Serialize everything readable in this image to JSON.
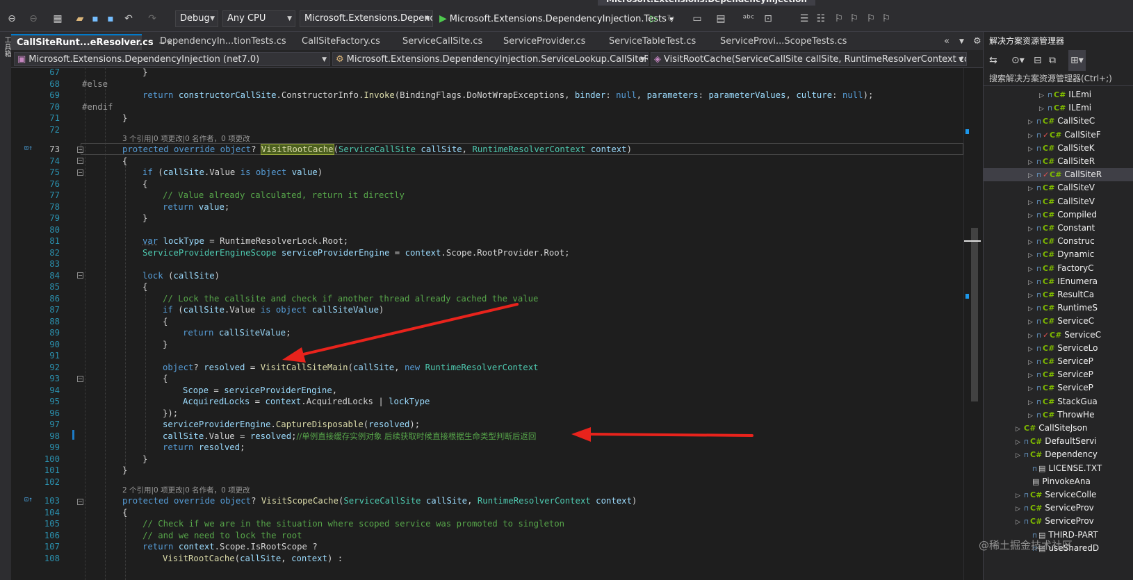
{
  "window": {
    "title": "Microsoft.Extensions.DependencyInjection"
  },
  "toolbar": {
    "config": "Debug",
    "platform": "Any CPU",
    "startup_project": "Microsoft.Extensions.Dependen",
    "run_target": "Microsoft.Extensions.DependencyInjection.Tests"
  },
  "left_strip": {
    "label": "工具箱"
  },
  "tabs": [
    {
      "label": "CallSiteRunt...eResolver.cs",
      "active": true
    },
    {
      "label": "DependencyIn...tionTests.cs"
    },
    {
      "label": "CallSiteFactory.cs"
    },
    {
      "label": "ServiceCallSite.cs"
    },
    {
      "label": "ServiceProvider.cs"
    },
    {
      "label": "ServiceTableTest.cs"
    },
    {
      "label": "ServiceProvi...ScopeTests.cs"
    }
  ],
  "navbar": {
    "project": "Microsoft.Extensions.DependencyInjection (net7.0)",
    "type": "Microsoft.Extensions.DependencyInjection.ServiceLookup.CallSiteRuntimeRe",
    "member": "VisitRootCache(ServiceCallSite callSite, RuntimeResolverContext context)"
  },
  "codelens": {
    "l72": "3 个引用|0 项更改|0 名作者，0 项更改",
    "l102": "2 个引用|0 项更改|0 名作者，0 项更改"
  },
  "code": {
    "l67": "}",
    "l68a": "#else",
    "l69a": "return ",
    "l69b": "constructorCallSite",
    "l69c": ".ConstructorInfo.",
    "l69d": "Invoke",
    "l69e": "(BindingFlags.DoNotWrapExceptions, ",
    "l69f": "binder",
    "l69g": ": ",
    "l69h": "null",
    "l69i": ", ",
    "l69j": "parameters",
    "l69k": ": ",
    "l69l": "parameterValues",
    "l69m": ", ",
    "l69n": "culture",
    "l69o": ": ",
    "l69p": "null",
    "l69q": ");",
    "l70a": "#endif",
    "l71": "}",
    "l73a": "protected override object",
    "l73b": "? ",
    "l73c": "VisitRootCache",
    "l73d": "(",
    "l73e": "ServiceCallSite",
    "l73f": " callSite",
    "l73g": ", ",
    "l73h": "RuntimeResolverContext",
    "l73i": " context",
    "l73j": ")",
    "l74": "{",
    "l75a": "if",
    "l75b": " (",
    "l75c": "callSite",
    "l75d": ".Value ",
    "l75e": "is object",
    "l75f": " value",
    "l75g": ")",
    "l76": "{",
    "l77": "// Value already calculated, return it directly",
    "l78a": "return",
    "l78b": " value",
    "l78c": ";",
    "l79": "}",
    "l81a": "var",
    "l81b": " lockType",
    "l81c": " = RuntimeResolverLock.Root;",
    "l82a": "ServiceProviderEngineScope",
    "l82b": " serviceProviderEngine",
    "l82c": " = ",
    "l82d": "context",
    "l82e": ".Scope.RootProvider.Root;",
    "l84a": "lock",
    "l84b": " (",
    "l84c": "callSite",
    "l84d": ")",
    "l85": "{",
    "l86": "// Lock the callsite and check if another thread already cached the value",
    "l87a": "if",
    "l87b": " (",
    "l87c": "callSite",
    "l87d": ".Value ",
    "l87e": "is object",
    "l87f": " callSiteValue",
    "l87g": ")",
    "l88": "{",
    "l89a": "return",
    "l89b": " callSiteValue",
    "l89c": ";",
    "l90": "}",
    "l92a": "object",
    "l92b": "? ",
    "l92c": "resolved",
    "l92d": " = ",
    "l92e": "VisitCallSiteMain",
    "l92f": "(",
    "l92g": "callSite",
    "l92h": ", ",
    "l92i": "new",
    "l92j": " RuntimeResolverContext",
    "l93": "{",
    "l94a": "Scope",
    "l94b": " = ",
    "l94c": "serviceProviderEngine",
    "l94d": ",",
    "l95a": "AcquiredLocks",
    "l95b": " = ",
    "l95c": "context",
    "l95d": ".AcquiredLocks | ",
    "l95e": "lockType",
    "l96": "});",
    "l97a": "serviceProviderEngine",
    "l97b": ".",
    "l97c": "CaptureDisposable",
    "l97d": "(",
    "l97e": "resolved",
    "l97f": ");",
    "l98a": "callSite",
    "l98b": ".Value = ",
    "l98c": "resolved",
    "l98d": ";",
    "l98e": "//单例直接缓存实例对象 后续获取时候直接根据生命类型判断后返回",
    "l99a": "return",
    "l99b": " resolved",
    "l99c": ";",
    "l100": "}",
    "l101": "}",
    "l103a": "protected override object",
    "l103b": "? ",
    "l103c": "VisitScopeCache",
    "l103d": "(",
    "l103e": "ServiceCallSite",
    "l103f": " callSite",
    "l103g": ", ",
    "l103h": "RuntimeResolverContext",
    "l103i": " context",
    "l103j": ")",
    "l104": "{",
    "l105": "// Check if we are in the situation where scoped service was promoted to singleton",
    "l106": "// and we need to lock the root",
    "l107a": "return",
    "l107b": " context",
    "l107c": ".Scope.IsRootScope ?",
    "l108a": "VisitRootCache",
    "l108b": "(",
    "l108c": "callSite",
    "l108d": ", ",
    "l108e": "context",
    "l108f": ") :"
  },
  "line_numbers": [
    "67",
    "68",
    "69",
    "70",
    "71",
    "72",
    "73",
    "74",
    "75",
    "76",
    "77",
    "78",
    "79",
    "80",
    "81",
    "82",
    "83",
    "84",
    "85",
    "86",
    "87",
    "88",
    "89",
    "90",
    "91",
    "92",
    "93",
    "94",
    "95",
    "96",
    "97",
    "98",
    "99",
    "100",
    "101",
    "102",
    "103",
    "104",
    "105",
    "106",
    "107",
    "108"
  ],
  "solution_explorer": {
    "title": "解决方案资源管理器",
    "search": "搜索解决方案资源管理器(Ctrl+;)",
    "items": [
      "ILEmi",
      "ILEmi",
      "CallSiteC",
      "CallSiteF",
      "CallSiteK",
      "CallSiteR",
      "CallSiteR",
      "CallSiteV",
      "CallSiteV",
      "Compiled",
      "Constant",
      "Construc",
      "Dynamic",
      "FactoryC",
      "IEnumera",
      "ResultCa",
      "RuntimeS",
      "ServiceC",
      "ServiceC",
      "ServiceLo",
      "ServiceP",
      "ServiceP",
      "ServiceP",
      "StackGua",
      "ThrowHe",
      "CallSiteJson",
      "DefaultServi",
      "Dependency",
      "LICENSE.TXT",
      "PinvokeAna",
      "ServiceColle",
      "ServiceProv",
      "ServiceProv",
      "THIRD-PART",
      "useSharedD"
    ]
  },
  "watermark": "@稀土掘金技术社区",
  "colors": {
    "accent": "#007acc",
    "arrow": "#e8231c",
    "background": "#1e1e1e"
  }
}
